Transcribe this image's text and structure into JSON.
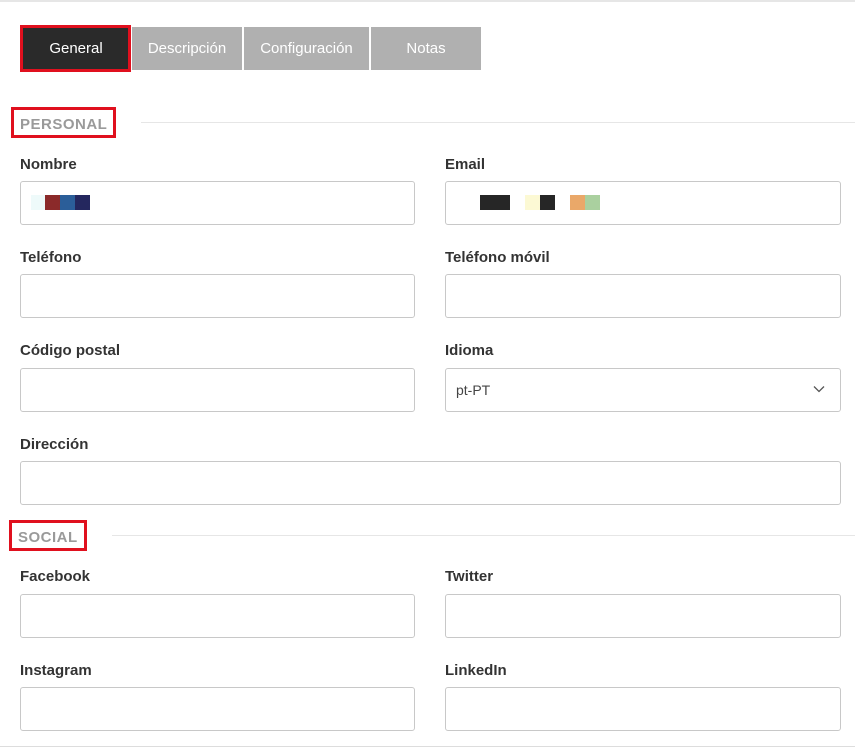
{
  "tabs": [
    {
      "label": "General",
      "active": true
    },
    {
      "label": "Descripción",
      "active": false
    },
    {
      "label": "Configuración",
      "active": false
    },
    {
      "label": "Notas",
      "active": false
    }
  ],
  "sections": {
    "personal": "PERSONAL",
    "social": "SOCIAL"
  },
  "fields": {
    "nombre": {
      "label": "Nombre",
      "value": ""
    },
    "email": {
      "label": "Email",
      "value": ""
    },
    "telefono": {
      "label": "Teléfono",
      "value": ""
    },
    "telefono_movil": {
      "label": "Teléfono móvil",
      "value": ""
    },
    "codigo_postal": {
      "label": "Código postal",
      "value": ""
    },
    "idioma": {
      "label": "Idioma",
      "value": "pt-PT"
    },
    "direccion": {
      "label": "Dirección",
      "value": ""
    },
    "facebook": {
      "label": "Facebook",
      "value": ""
    },
    "twitter": {
      "label": "Twitter",
      "value": ""
    },
    "instagram": {
      "label": "Instagram",
      "value": ""
    },
    "linkedin": {
      "label": "LinkedIn",
      "value": ""
    }
  },
  "colors": {
    "active_tab": "#2a2a2a",
    "inactive_tab": "#b0b0b0",
    "highlight": "#e0101e",
    "section_text": "#9a9a9a"
  },
  "icons": {
    "select_arrow": "chevron-down-icon"
  }
}
